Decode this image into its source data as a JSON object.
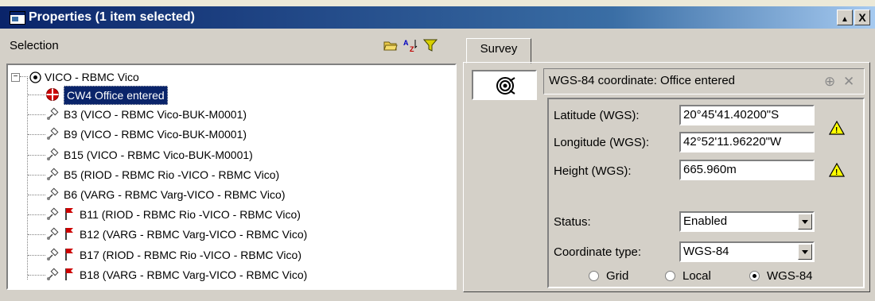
{
  "window": {
    "title": "Properties (1 item selected)",
    "maximize_glyph": "▲",
    "close_glyph": "X"
  },
  "selection": {
    "label": "Selection",
    "tools": [
      "folder-icon",
      "sort-az-icon",
      "filter-icon"
    ],
    "root": {
      "label": "VICO - RBMC Vico",
      "expander": "−"
    },
    "items": [
      {
        "label": "CW4 Office entered",
        "icon": "control-point-icon",
        "selected": true,
        "flag": false
      },
      {
        "label": "B3 (VICO - RBMC Vico-BUK-M0001)",
        "icon": "satellite-icon",
        "selected": false,
        "flag": false
      },
      {
        "label": "B9 (VICO - RBMC Vico-BUK-M0001)",
        "icon": "satellite-icon",
        "selected": false,
        "flag": false
      },
      {
        "label": "B15 (VICO - RBMC Vico-BUK-M0001)",
        "icon": "satellite-icon",
        "selected": false,
        "flag": false
      },
      {
        "label": "B5 (RIOD - RBMC Rio -VICO - RBMC Vico)",
        "icon": "satellite-icon",
        "selected": false,
        "flag": false
      },
      {
        "label": "B6 (VARG - RBMC Varg-VICO - RBMC Vico)",
        "icon": "satellite-icon",
        "selected": false,
        "flag": false
      },
      {
        "label": "B11 (RIOD - RBMC Rio -VICO - RBMC Vico)",
        "icon": "satellite-icon",
        "selected": false,
        "flag": true
      },
      {
        "label": "B12 (VARG - RBMC Varg-VICO - RBMC Vico)",
        "icon": "satellite-icon",
        "selected": false,
        "flag": true
      },
      {
        "label": "B17 (RIOD - RBMC Rio -VICO - RBMC Vico)",
        "icon": "satellite-icon",
        "selected": false,
        "flag": true
      },
      {
        "label": "B18 (VARG - RBMC Varg-VICO - RBMC Vico)",
        "icon": "satellite-icon",
        "selected": false,
        "flag": true
      }
    ]
  },
  "tabs": [
    {
      "label": "Survey",
      "active": true
    }
  ],
  "survey": {
    "header": "WGS-84 coordinate: Office entered",
    "fields": {
      "latitude": {
        "label": "Latitude (WGS):",
        "value": "20°45'41.40200\"S"
      },
      "longitude": {
        "label": "Longitude (WGS):",
        "value": "42°52'11.96220\"W"
      },
      "height": {
        "label": "Height (WGS):",
        "value": "665.960m"
      },
      "status": {
        "label": "Status:",
        "value": "Enabled"
      },
      "coord_type": {
        "label": "Coordinate type:",
        "value": "WGS-84"
      }
    },
    "radios": [
      {
        "label": "Grid",
        "checked": false
      },
      {
        "label": "Local",
        "checked": false
      },
      {
        "label": "WGS-84",
        "checked": true
      }
    ]
  },
  "colors": {
    "titlebar_start": "#0a246a",
    "selection_highlight": "#0a246a",
    "warning_yellow": "#ffff00",
    "flag_red": "#cc0000"
  }
}
